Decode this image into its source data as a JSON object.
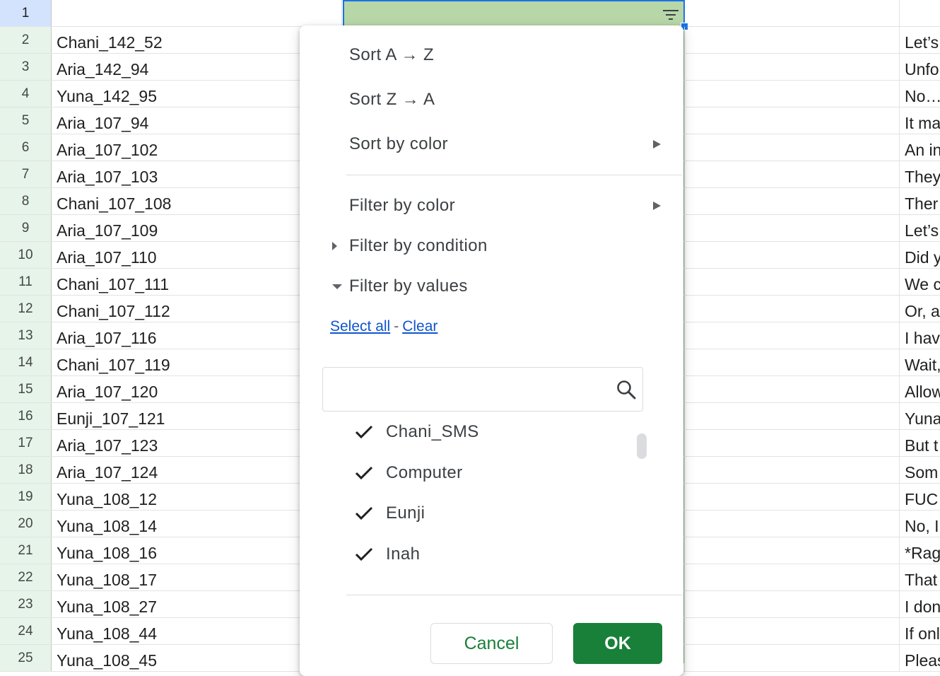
{
  "header": {
    "row_number": "1"
  },
  "rows": [
    {
      "num": "2",
      "a": "Chani_142_52",
      "d": "Let’s"
    },
    {
      "num": "3",
      "a": "Aria_142_94",
      "d": "Unfo"
    },
    {
      "num": "4",
      "a": "Yuna_142_95",
      "d": "No…"
    },
    {
      "num": "5",
      "a": "Aria_107_94",
      "d": "It ma"
    },
    {
      "num": "6",
      "a": "Aria_107_102",
      "d": "An in"
    },
    {
      "num": "7",
      "a": "Aria_107_103",
      "d": "They"
    },
    {
      "num": "8",
      "a": "Chani_107_108",
      "d": "Ther"
    },
    {
      "num": "9",
      "a": "Aria_107_109",
      "d": "Let’s"
    },
    {
      "num": "10",
      "a": "Aria_107_110",
      "d": "Did y"
    },
    {
      "num": "11",
      "a": "Chani_107_111",
      "d": "We c"
    },
    {
      "num": "12",
      "a": "Chani_107_112",
      "d": "Or, a"
    },
    {
      "num": "13",
      "a": "Aria_107_116",
      "d": "I hav"
    },
    {
      "num": "14",
      "a": "Chani_107_119",
      "d": "Wait,"
    },
    {
      "num": "15",
      "a": "Aria_107_120",
      "d": "Allow"
    },
    {
      "num": "16",
      "a": "Eunji_107_121",
      "d": "Yuna"
    },
    {
      "num": "17",
      "a": "Aria_107_123",
      "d": "But t"
    },
    {
      "num": "18",
      "a": "Aria_107_124",
      "d": "Som"
    },
    {
      "num": "19",
      "a": "Yuna_108_12",
      "d": "FUC"
    },
    {
      "num": "20",
      "a": "Yuna_108_14",
      "d": "No, I"
    },
    {
      "num": "21",
      "a": "Yuna_108_16",
      "d": "*Rag"
    },
    {
      "num": "22",
      "a": "Yuna_108_17",
      "d": "That"
    },
    {
      "num": "23",
      "a": "Yuna_108_27",
      "d": "I don"
    },
    {
      "num": "24",
      "a": "Yuna_108_44",
      "d": "If onl"
    },
    {
      "num": "25",
      "a": "Yuna_108_45",
      "d": "Pleas"
    }
  ],
  "menu": {
    "sort_az": "Sort A → Z",
    "sort_za": "Sort Z → A",
    "sort_by_color": "Sort by color",
    "filter_by_color": "Filter by color",
    "filter_by_condition": "Filter by condition",
    "filter_by_values": "Filter by values",
    "select_all": "Select all",
    "separator": "-",
    "clear": "Clear",
    "search_value": "",
    "values": [
      "Chani_SMS",
      "Computer",
      "Eunji",
      "Inah"
    ],
    "cancel": "Cancel",
    "ok": "OK"
  },
  "colors": {
    "accent_green": "#188038",
    "link_blue": "#1155cc",
    "selection_blue": "#1a73e8",
    "header_fill": "#b7d7a8"
  }
}
